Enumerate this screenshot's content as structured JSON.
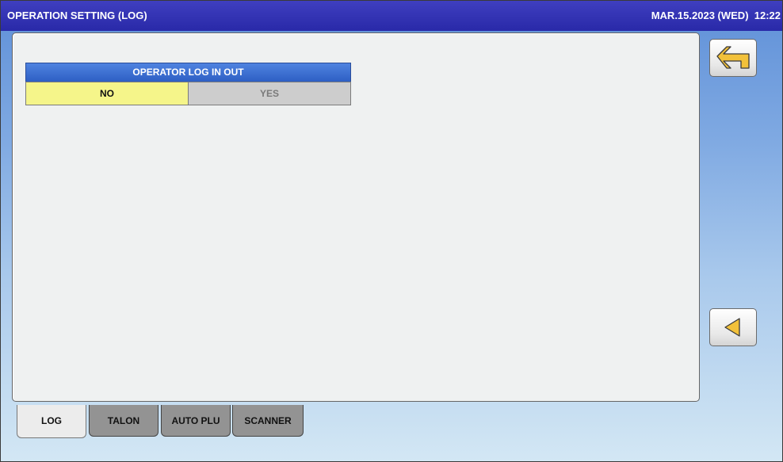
{
  "header": {
    "title": "OPERATION SETTING (LOG)",
    "datetime": "MAR.15.2023 (WED)  12:22"
  },
  "setting": {
    "label": "OPERATOR LOG IN OUT",
    "options": [
      {
        "label": "NO",
        "selected": true
      },
      {
        "label": "YES",
        "selected": false
      }
    ]
  },
  "side_buttons": {
    "return_icon": "return-arrow-icon",
    "previous_icon": "triangle-left-icon"
  },
  "tabs": [
    {
      "label": "LOG",
      "active": true
    },
    {
      "label": "TALON",
      "active": false
    },
    {
      "label": "AUTO PLU",
      "active": false
    },
    {
      "label": "SCANNER",
      "active": false
    }
  ],
  "colors": {
    "title_bar": "#2929a8",
    "section_header": "#3a6fd2",
    "selected_option": "#f5f58a",
    "unselected_option": "#cdcdcd",
    "icon_fill": "#f2c13a"
  }
}
